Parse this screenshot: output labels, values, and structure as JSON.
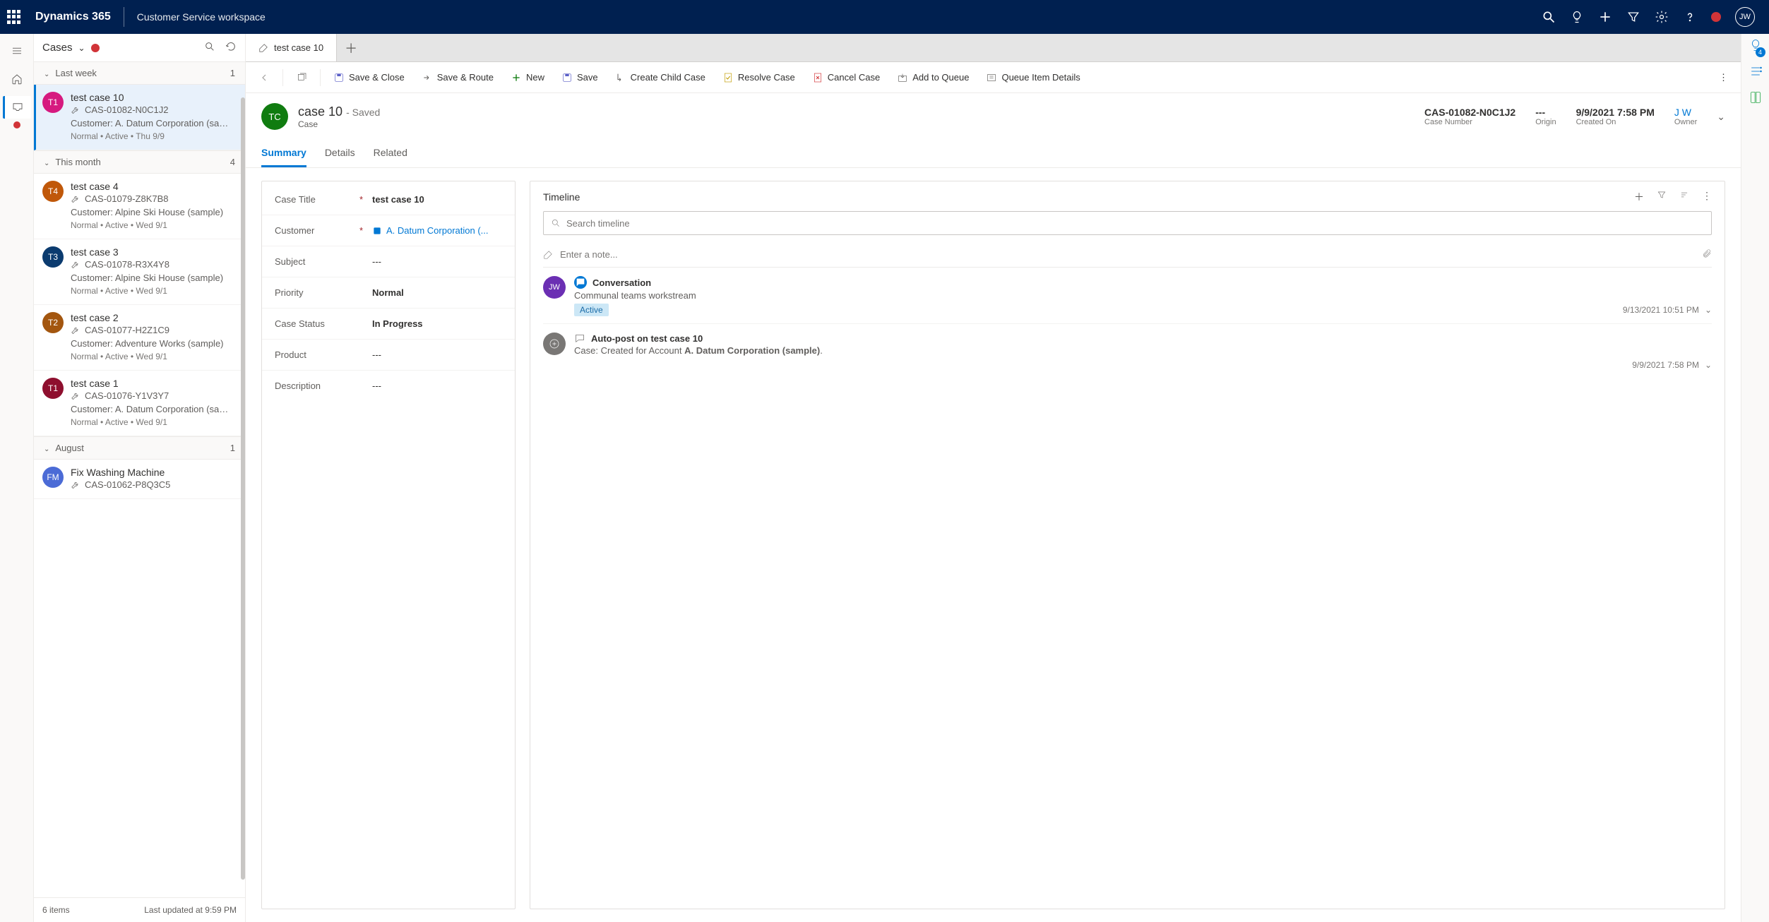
{
  "top": {
    "brand": "Dynamics 365",
    "appName": "Customer Service workspace",
    "userInitials": "JW"
  },
  "listPanel": {
    "title": "Cases",
    "groups": [
      {
        "label": "Last week",
        "count": "1"
      },
      {
        "label": "This month",
        "count": "4"
      },
      {
        "label": "August",
        "count": "1"
      }
    ],
    "items": [
      {
        "initials": "T1",
        "color": "#d61a7f",
        "title": "test case 10",
        "caseNo": "CAS-01082-N0C1J2",
        "customer": "Customer: A. Datum Corporation (sampl...",
        "meta": "Normal • Active • Thu 9/9",
        "selected": true,
        "group": 0
      },
      {
        "initials": "T4",
        "color": "#c0580a",
        "title": "test case 4",
        "caseNo": "CAS-01079-Z8K7B8",
        "customer": "Customer: Alpine Ski House (sample)",
        "meta": "Normal • Active • Wed 9/1",
        "group": 1
      },
      {
        "initials": "T3",
        "color": "#0b3b6f",
        "title": "test case 3",
        "caseNo": "CAS-01078-R3X4Y8",
        "customer": "Customer: Alpine Ski House (sample)",
        "meta": "Normal • Active • Wed 9/1",
        "group": 1
      },
      {
        "initials": "T2",
        "color": "#a3560f",
        "title": "test case 2",
        "caseNo": "CAS-01077-H2Z1C9",
        "customer": "Customer: Adventure Works (sample)",
        "meta": "Normal • Active • Wed 9/1",
        "group": 1
      },
      {
        "initials": "T1",
        "color": "#8e0f2e",
        "title": "test case 1",
        "caseNo": "CAS-01076-Y1V3Y7",
        "customer": "Customer: A. Datum Corporation (sampl...",
        "meta": "Normal • Active • Wed 9/1",
        "group": 1
      },
      {
        "initials": "FM",
        "color": "#4b6bd6",
        "title": "Fix Washing Machine",
        "caseNo": "CAS-01062-P8Q3C5",
        "customer": "",
        "meta": "",
        "group": 2
      }
    ],
    "footer": {
      "count": "6 items",
      "updated": "Last updated at 9:59 PM"
    }
  },
  "tab": {
    "label": "test case 10"
  },
  "commands": {
    "saveClose": "Save & Close",
    "saveRoute": "Save & Route",
    "new": "New",
    "save": "Save",
    "createChild": "Create Child Case",
    "resolve": "Resolve Case",
    "cancel": "Cancel Case",
    "addQueue": "Add to Queue",
    "queueDetails": "Queue Item Details"
  },
  "record": {
    "badge": "TC",
    "name": "case 10",
    "saved": "- Saved",
    "type": "Case",
    "headerFields": [
      {
        "val": "CAS-01082-N0C1J2",
        "lbl": "Case Number"
      },
      {
        "val": "---",
        "lbl": "Origin"
      },
      {
        "val": "9/9/2021 7:58 PM",
        "lbl": "Created On"
      },
      {
        "val": "J W",
        "lbl": "Owner",
        "link": true
      }
    ],
    "tabs": {
      "summary": "Summary",
      "details": "Details",
      "related": "Related"
    },
    "fields": [
      {
        "label": "Case Title",
        "req": true,
        "value": "test case 10",
        "bold": true
      },
      {
        "label": "Customer",
        "req": true,
        "value": "A. Datum Corporation (...",
        "link": true
      },
      {
        "label": "Subject",
        "req": false,
        "value": "---"
      },
      {
        "label": "Priority",
        "req": false,
        "value": "Normal",
        "bold": true
      },
      {
        "label": "Case Status",
        "req": false,
        "value": "In Progress",
        "bold": true
      },
      {
        "label": "Product",
        "req": false,
        "value": "---"
      },
      {
        "label": "Description",
        "req": false,
        "value": "---"
      }
    ]
  },
  "timeline": {
    "title": "Timeline",
    "searchPlaceholder": "Search timeline",
    "notePlaceholder": "Enter a note...",
    "items": [
      {
        "avatarInitials": "JW",
        "avatarColor": "#6b2fb3",
        "iconColor": "#0078d4",
        "title": "Conversation",
        "desc": "Communal teams workstream",
        "status": "Active",
        "when": "9/13/2021 10:51 PM"
      },
      {
        "avatarInitials": "",
        "avatarColor": "#797775",
        "iconColor": "#605e5c",
        "title": "Auto-post on test case 10",
        "descPrefix": "Case: Created for Account ",
        "descBold": "A. Datum Corporation (sample)",
        "descSuffix": ".",
        "when": "9/9/2021 7:58 PM"
      }
    ]
  },
  "rightRail": {
    "badgeCount": "4"
  }
}
